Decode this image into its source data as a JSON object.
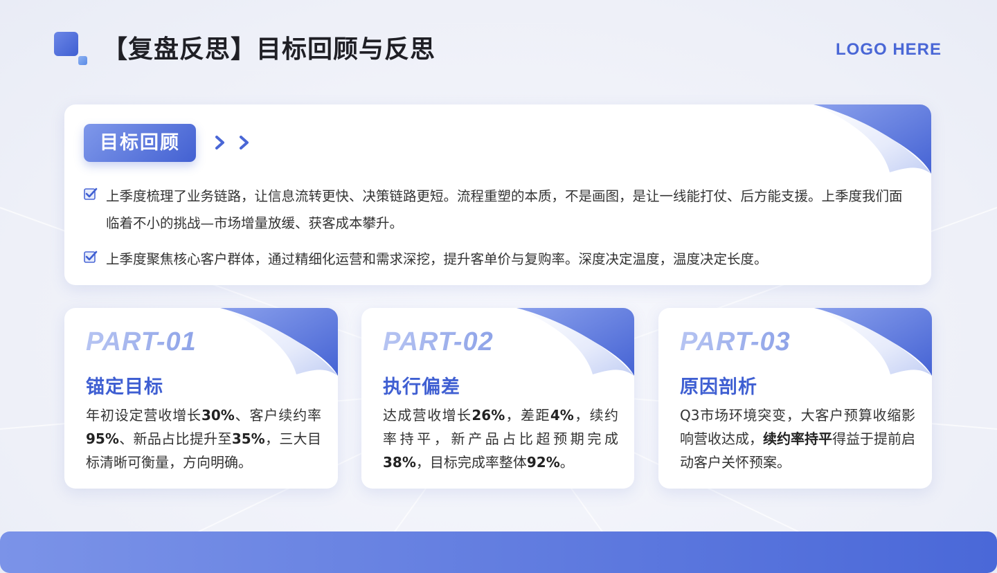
{
  "header": {
    "title": "【复盘反思】目标回顾与反思",
    "logo_text": "LOGO HERE"
  },
  "review": {
    "tag": "目标回顾",
    "bullets": [
      "上季度梳理了业务链路，让信息流转更快、决策链路更短。流程重塑的本质，不是画图，是让一线能打仗、后方能支援。上季度我们面临着不小的挑战—市场增量放缓、获客成本攀升。",
      "上季度聚焦核心客户群体，通过精细化运营和需求深挖，提升客单价与复购率。深度决定温度，温度决定长度。"
    ]
  },
  "parts": [
    {
      "num": "PART-01",
      "title": "锚定目标",
      "segments": [
        {
          "t": "年初设定营收增长",
          "b": false
        },
        {
          "t": "30%",
          "b": true
        },
        {
          "t": "、客户续约率",
          "b": false
        },
        {
          "t": "95%",
          "b": true
        },
        {
          "t": "、新品占比提升至",
          "b": false
        },
        {
          "t": "35%",
          "b": true
        },
        {
          "t": "，三大目标清晰可衡量，方向明确。",
          "b": false
        }
      ]
    },
    {
      "num": "PART-02",
      "title": "执行偏差",
      "segments": [
        {
          "t": "达成营收增长",
          "b": false
        },
        {
          "t": "26%",
          "b": true
        },
        {
          "t": "，差距",
          "b": false
        },
        {
          "t": "4%",
          "b": true
        },
        {
          "t": "，续约率持平，新产品占比超预期完成",
          "b": false
        },
        {
          "t": "38%",
          "b": true
        },
        {
          "t": "，目标完成率整体",
          "b": false
        },
        {
          "t": "92%",
          "b": true
        },
        {
          "t": "。",
          "b": false
        }
      ]
    },
    {
      "num": "PART-03",
      "title": "原因剖析",
      "segments": [
        {
          "t": "Q3市场环境突变，大客户预算收缩影响营收达成，",
          "b": false
        },
        {
          "t": "续约率持平",
          "b": true
        },
        {
          "t": "得益于提前启动客户关怀预案。",
          "b": false
        }
      ]
    }
  ],
  "colors": {
    "accent": "#4361d2",
    "accent_light": "#7f98ea",
    "part_number": "#a9b9ef",
    "title_text": "#1f1f25"
  },
  "icons": {
    "checkbox": "checkbox-checked-icon",
    "chevron": "chevron-right-icon",
    "page_curl": "page-curl-decoration"
  }
}
